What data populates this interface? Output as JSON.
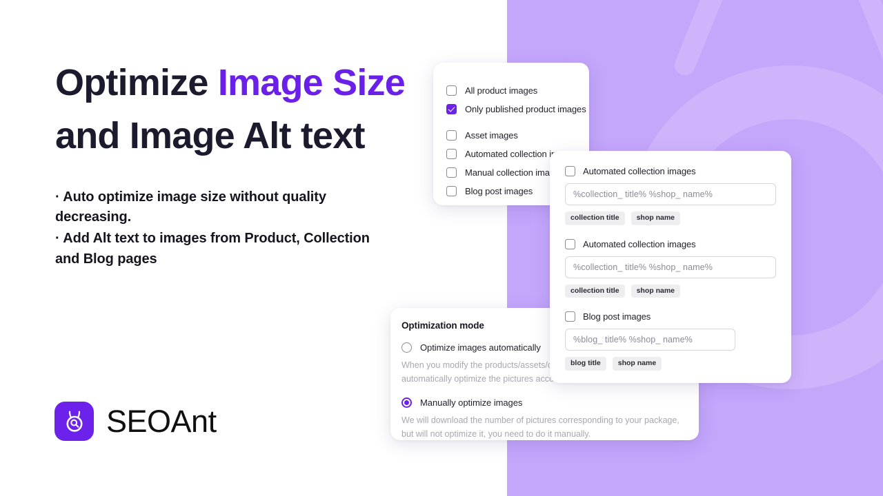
{
  "colors": {
    "accent": "#6a20e8",
    "logo_mark": "#6d22ec",
    "panel_purple": "#c4a6fb",
    "watermark_purple": "#cfb4fc",
    "headline_dark": "#1c1b2e",
    "page_background": "#ffffff"
  },
  "hero": {
    "headline_line1_plain": "Optimize ",
    "headline_line1_accent": "Image Size",
    "headline_line2": "and Image Alt text",
    "bullets": [
      "· Auto optimize image size without quality decreasing.",
      "· Add Alt text to images from Product, Collection and Blog pages"
    ]
  },
  "logo": {
    "name": "SEOAnt",
    "icon": "seoant-ant-magnifier-icon"
  },
  "product_list_card": {
    "items": [
      {
        "label": "All product images",
        "checked": false
      },
      {
        "label": "Only published product images",
        "checked": true
      },
      {
        "label": "Asset images",
        "checked": false
      },
      {
        "label": "Automated collection images",
        "checked": false
      },
      {
        "label": "Manual collection images",
        "checked": false
      },
      {
        "label": "Blog post images",
        "checked": false
      }
    ]
  },
  "alt_text_card": {
    "groups": [
      {
        "label": "Automated collection images",
        "checked": false,
        "input_value": "%collection_ title% %shop_ name%",
        "tags": [
          "collection title",
          "shop name"
        ]
      },
      {
        "label": "Automated collection images",
        "checked": false,
        "input_value": "%collection_ title% %shop_ name%",
        "tags": [
          "collection title",
          "shop name"
        ]
      },
      {
        "label": "Blog post images",
        "checked": false,
        "input_value": "%blog_ title% %shop_ name%",
        "tags": [
          "blog title",
          "shop name"
        ]
      }
    ]
  },
  "optimization_mode_card": {
    "title": "Optimization mode",
    "options": [
      {
        "label": "Optimize images automatically",
        "selected": false,
        "description_line1": "When you modify the products/assets/co",
        "description_line2": "automatically optimize the pictures acco"
      },
      {
        "label": "Manually optimize images",
        "selected": true,
        "description": "We will download the number of pictures corresponding to your package, but will not optimize it, you need to do it manually."
      }
    ]
  }
}
